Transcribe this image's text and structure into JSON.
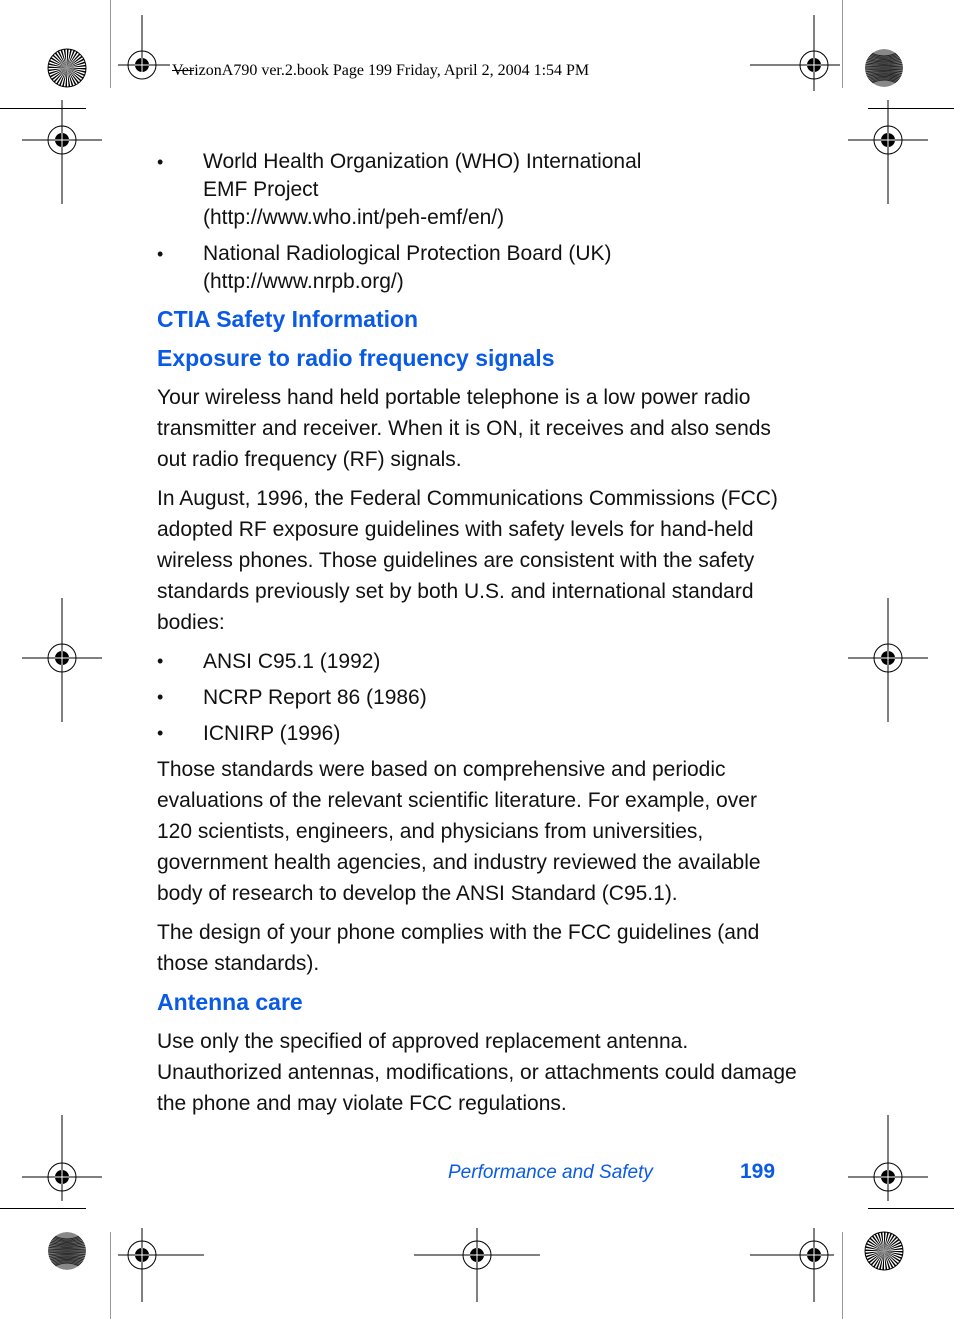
{
  "print_slug": "VerizonA790 ver.2.book  Page 199  Friday, April 2, 2004  1:54 PM",
  "bullets_top": [
    {
      "lines": [
        "World Health Organization (WHO) International",
        "EMF Project",
        "(http://www.who.int/peh-emf/en/)"
      ]
    },
    {
      "lines": [
        "National Radiological Protection Board (UK)",
        "(http://www.nrpb.org/)"
      ]
    }
  ],
  "section_heading": "CTIA Safety Information",
  "subsections": [
    {
      "heading": "Exposure to radio frequency signals",
      "paragraphs": [
        "Your wireless hand held portable telephone is a low power radio transmitter and receiver. When it is ON, it receives and also sends out radio frequency (RF) signals.",
        "In August, 1996, the Federal Communications Commissions (FCC) adopted RF exposure guidelines with safety levels for hand-held wireless phones. Those guidelines are consistent with the safety standards previously set by both U.S. and international standard bodies:"
      ],
      "standards": [
        "ANSI C95.1 (1992)",
        "NCRP Report 86 (1986)",
        "ICNIRP (1996)"
      ],
      "paragraphs_after": [
        "Those standards were based on comprehensive and periodic evaluations of the relevant scientific literature. For example, over 120 scientists, engineers, and physicians from universities, government health agencies, and industry reviewed the available body of research to develop the ANSI Standard (C95.1).",
        "The design of your phone complies with the FCC guidelines (and those standards)."
      ]
    },
    {
      "heading": "Antenna care",
      "paragraphs": [
        "Use only the specified of approved replacement antenna. Unauthorized antennas, modifications, or attachments could damage the phone and may violate FCC regulations."
      ]
    }
  ],
  "footer": {
    "section_title": "Performance and Safety",
    "page_number": "199"
  },
  "colors": {
    "heading_blue": "#0a5ae6",
    "text": "#111111"
  }
}
